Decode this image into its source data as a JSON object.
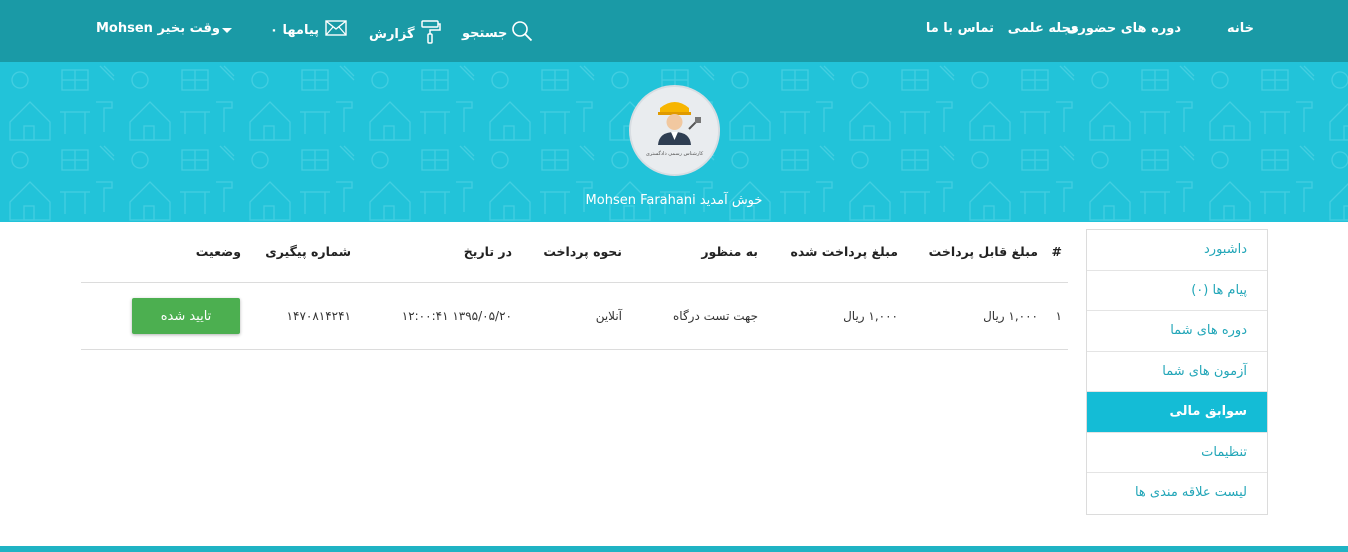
{
  "nav": {
    "home": "خانه",
    "in_person_courses": "دوره های حضوری",
    "magazine": "مجله علمی",
    "contact": "تماس با ما",
    "search": "جستجو",
    "report": "گزارش",
    "messages": "پیامها ۰",
    "greeting": "Mohsen وقت بخیر"
  },
  "banner": {
    "welcome": "Mohsen Farahani خوش آمدید",
    "avatar_caption": "کارشناس رسمی دادگستری"
  },
  "sidebar": {
    "items": [
      {
        "label": "داشبورد"
      },
      {
        "label": "پیام ها (۰)"
      },
      {
        "label": "دوره های شما"
      },
      {
        "label": "آزمون های شما"
      },
      {
        "label": "سوابق مالی"
      },
      {
        "label": "تنظیمات"
      },
      {
        "label": "لیست علاقه مندی ها"
      }
    ],
    "active_index": 4
  },
  "table": {
    "headers": {
      "idx": "#",
      "amount": "مبلغ قابل پرداخت",
      "paid": "مبلغ پرداخت شده",
      "purpose": "به منظور",
      "method": "نحوه پرداخت",
      "date": "در تاریخ",
      "tracking": "شماره پیگیری",
      "status": "وضعیت"
    },
    "rows": [
      {
        "idx": "۱",
        "amount": "۱,۰۰۰ ریال",
        "paid": "۱,۰۰۰ ریال",
        "purpose": "جهت تست درگاه",
        "method": "آنلاین",
        "date": "۱۳۹۵/۰۵/۲۰ ۱۲:۰۰:۴۱",
        "tracking": "۱۴۷۰۸۱۴۲۴۱",
        "status": "تایید شده"
      }
    ]
  },
  "colors": {
    "topbar": "#1a9aa6",
    "banner": "#22c3d9",
    "accent_text": "#22a6b8",
    "active_item": "#14bcd6",
    "status_green": "#4caf50"
  }
}
